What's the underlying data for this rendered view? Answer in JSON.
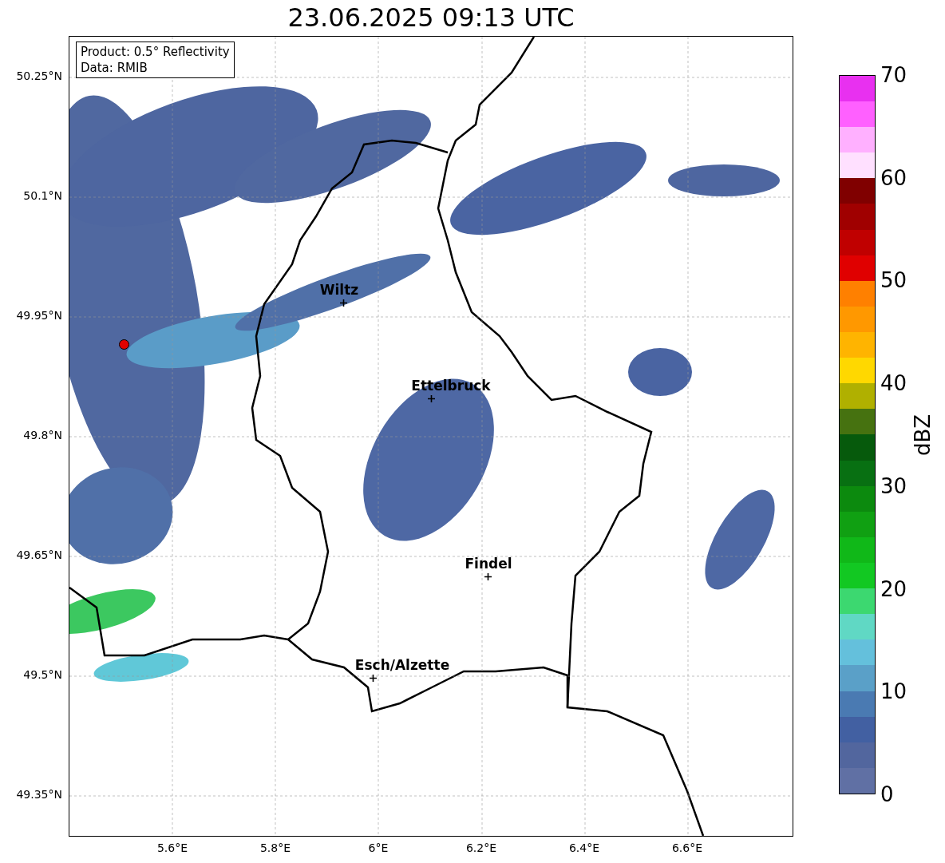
{
  "title": "23.06.2025 09:13 UTC",
  "info_box": {
    "lines": [
      "Product: 0.5° Reflectivity",
      "Data: RMIB"
    ]
  },
  "map": {
    "y_ticks": [
      "50.25°N",
      "50.1°N",
      "49.95°N",
      "49.8°N",
      "49.65°N",
      "49.5°N",
      "49.35°N"
    ],
    "x_ticks": [
      "5.6°E",
      "5.8°E",
      "6°E",
      "6.2°E",
      "6.4°E",
      "6.6°E"
    ],
    "places": [
      {
        "name": "Wiltz"
      },
      {
        "name": "Ettelbruck"
      },
      {
        "name": "Findel"
      },
      {
        "name": "Esch/Alzette"
      }
    ]
  },
  "colorbar": {
    "label": "dBZ",
    "ticks": [
      "70",
      "60",
      "50",
      "40",
      "30",
      "20",
      "10",
      "0"
    ],
    "bins": [
      {
        "color": "#6070a4"
      },
      {
        "color": "#52669e"
      },
      {
        "color": "#4260a2"
      },
      {
        "color": "#4a7ab2"
      },
      {
        "color": "#5aa0c8"
      },
      {
        "color": "#64c0dc"
      },
      {
        "color": "#60d8c4"
      },
      {
        "color": "#3cd870"
      },
      {
        "color": "#12c822"
      },
      {
        "color": "#10b818"
      },
      {
        "color": "#10a012"
      },
      {
        "color": "#0c8a0e"
      },
      {
        "color": "#087012"
      },
      {
        "color": "#065a0c"
      },
      {
        "color": "#467210"
      },
      {
        "color": "#b0b000"
      },
      {
        "color": "#ffd800"
      },
      {
        "color": "#ffb400"
      },
      {
        "color": "#ff9800"
      },
      {
        "color": "#ff8000"
      },
      {
        "color": "#e00000"
      },
      {
        "color": "#c00000"
      },
      {
        "color": "#a00000"
      },
      {
        "color": "#800000"
      },
      {
        "color": "#ffe0ff"
      },
      {
        "color": "#ffb0ff"
      },
      {
        "color": "#ff60ff"
      },
      {
        "color": "#e830f0"
      }
    ]
  }
}
